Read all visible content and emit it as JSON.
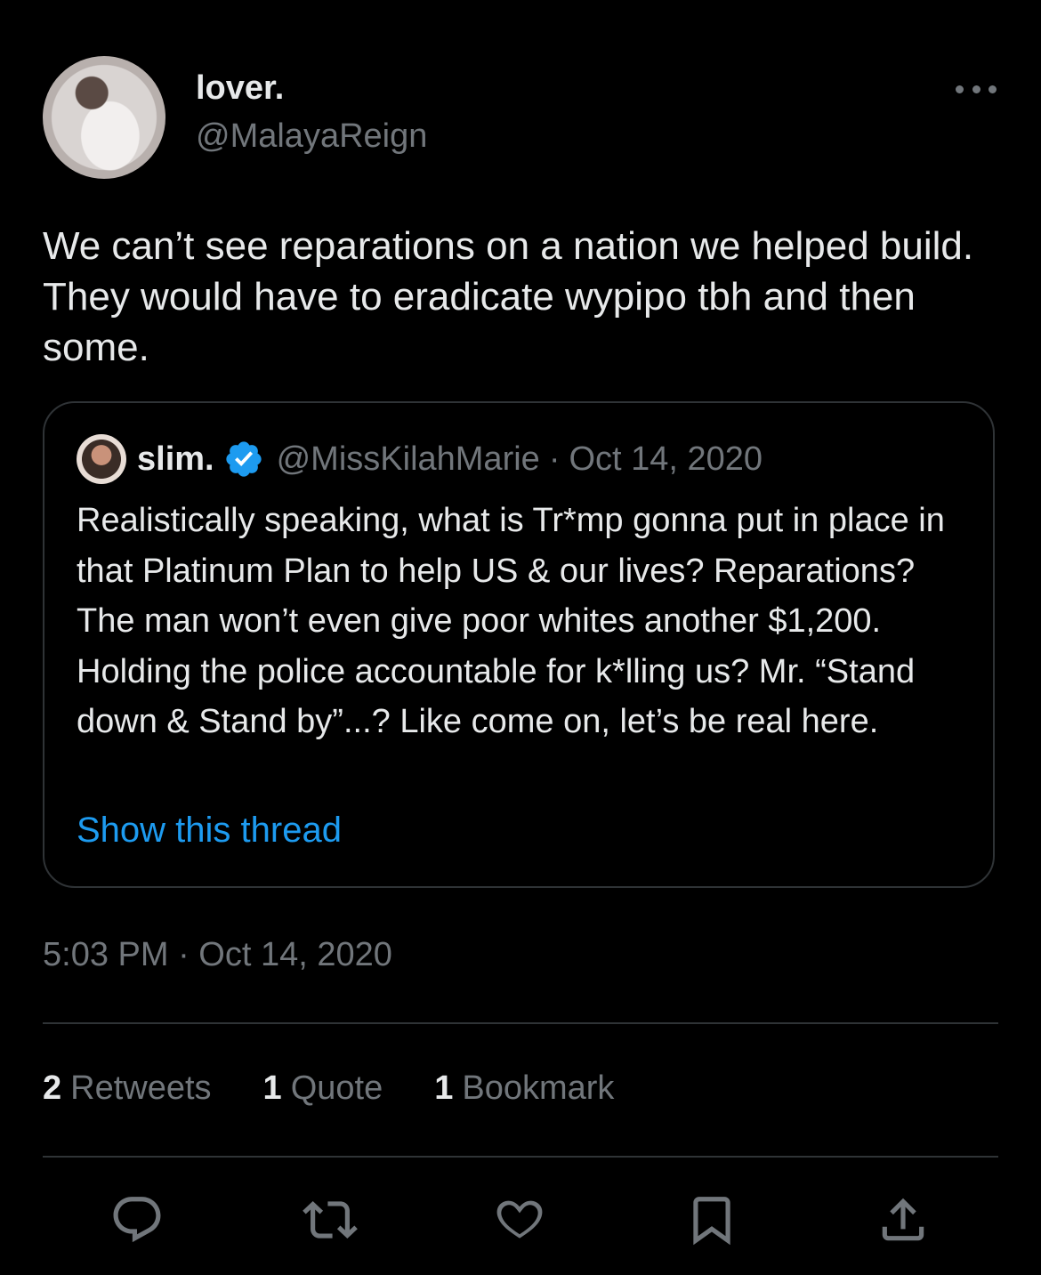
{
  "author": {
    "display_name": "lover.",
    "handle": "@MalayaReign"
  },
  "tweet": {
    "text": "We can’t see reparations on a nation we helped build. They would have to eradicate wypipo tbh and then some."
  },
  "quoted_tweet": {
    "display_name": "slim.",
    "handle": "@MissKilahMarie",
    "separator": "·",
    "date": "Oct 14, 2020",
    "text": "Realistically speaking, what is Tr*mp gonna put in place in that Platinum Plan to help US & our lives? Reparations? The man won’t even give poor whites another $1,200. Holding the police accountable for k*lling us? Mr. “Stand down & Stand by”...? Like come on, let’s be real here.",
    "show_thread_label": "Show this thread"
  },
  "timestamp": "5:03 PM · Oct 14, 2020",
  "stats": {
    "retweets_count": "2",
    "retweets_label": "Retweets",
    "quotes_count": "1",
    "quotes_label": "Quote",
    "bookmarks_count": "1",
    "bookmarks_label": "Bookmark"
  },
  "actions": [
    "reply-icon",
    "retweet-icon",
    "like-icon",
    "bookmark-icon",
    "share-icon"
  ],
  "colors": {
    "background": "#000000",
    "text": "#e7e9ea",
    "secondary_text": "#71767b",
    "accent": "#1d9bf0",
    "border": "#2f3336"
  }
}
